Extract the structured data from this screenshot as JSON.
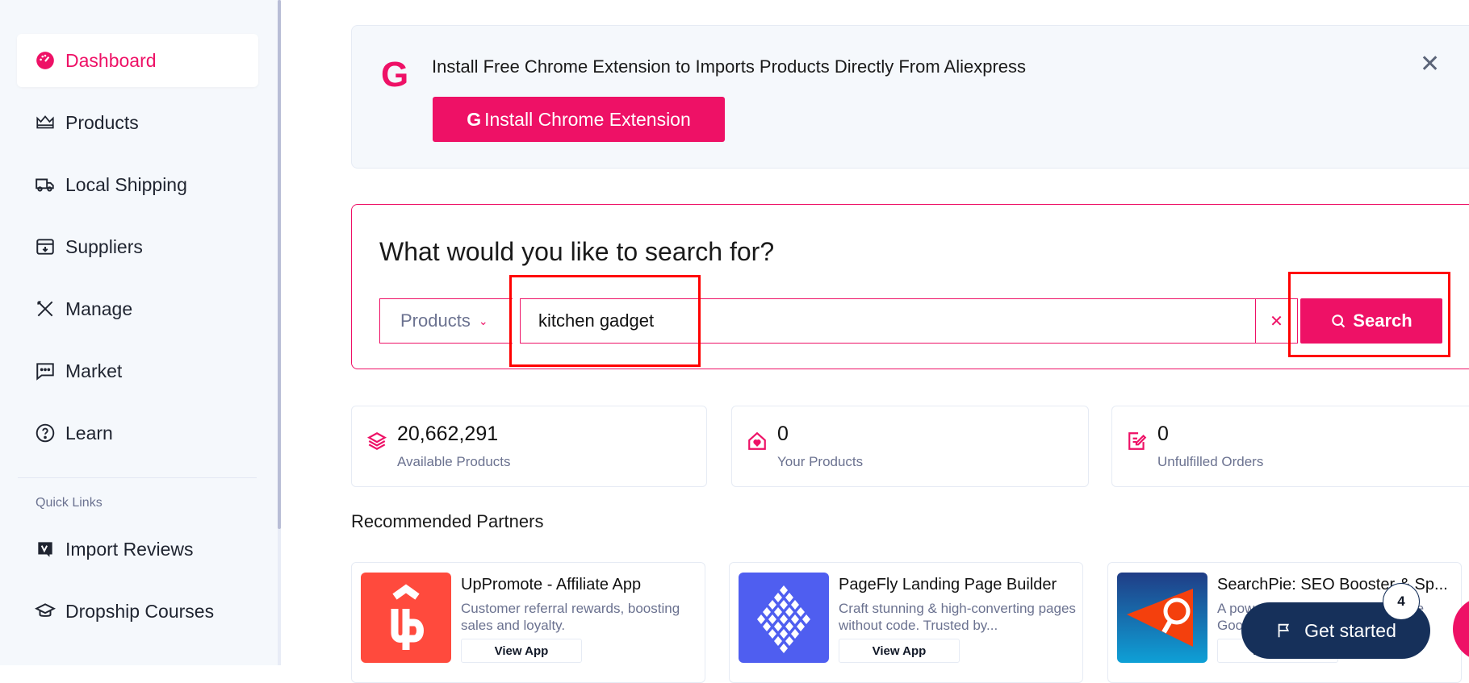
{
  "sidebar": {
    "items": [
      {
        "label": "Dashboard",
        "icon": "gauge-icon",
        "active": true
      },
      {
        "label": "Products",
        "icon": "crown-icon"
      },
      {
        "label": "Local Shipping",
        "icon": "truck-icon"
      },
      {
        "label": "Suppliers",
        "icon": "box-icon"
      },
      {
        "label": "Manage",
        "icon": "tools-icon"
      },
      {
        "label": "Market",
        "icon": "chat-icon"
      },
      {
        "label": "Learn",
        "icon": "question-icon"
      }
    ],
    "quick_links_label": "Quick Links",
    "quick_links": [
      {
        "label": "Import Reviews",
        "icon": "review-icon"
      },
      {
        "label": "Dropship Courses",
        "icon": "graduation-cap-icon"
      }
    ]
  },
  "banner": {
    "text": "Install Free Chrome Extension to Imports Products Directly From Aliexpress",
    "button_label": "Install Chrome Extension",
    "logo_letter": "G"
  },
  "search": {
    "title": "What would you like to search for?",
    "category": "Products",
    "query": "kitchen gadget",
    "button_label": "Search"
  },
  "stats": [
    {
      "value": "20,662,291",
      "label": "Available Products"
    },
    {
      "value": "0",
      "label": "Your Products"
    },
    {
      "value": "0",
      "label": "Unfulfilled Orders"
    }
  ],
  "partners_title": "Recommended Partners",
  "partners": [
    {
      "title": "UpPromote - Affiliate App",
      "desc": "Customer referral rewards, boosting sales and loyalty.",
      "button": "View App"
    },
    {
      "title": "PageFly Landing Page Builder",
      "desc": "Craft stunning & high-converting pages without code. Trusted by...",
      "button": "View App"
    },
    {
      "title": "SearchPie: SEO Booster & Sp...",
      "desc": "A powerful app that helps improve Google...",
      "button": "View App"
    }
  ],
  "get_started": {
    "label": "Get started",
    "badge": "4"
  },
  "colors": {
    "accent": "#ee1166",
    "navy": "#16305a",
    "highlight": "#ff0000"
  }
}
